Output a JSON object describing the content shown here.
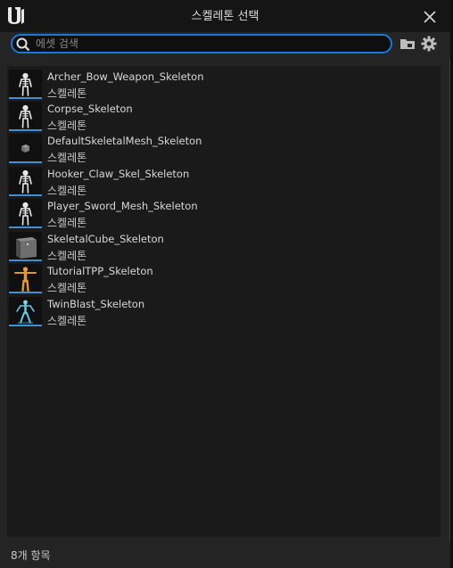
{
  "window": {
    "title": "스켈레톤 선택",
    "colors": {
      "accent": "#1a78d6",
      "background": "#242424",
      "panel": "#1a1a1a"
    }
  },
  "toolbar": {
    "search_placeholder": "에셋 검색",
    "search_value": "",
    "folder_icon": "folder-icon",
    "settings_icon": "gear-icon"
  },
  "assets": [
    {
      "name": "Archer_Bow_Weapon_Skeleton",
      "type": "스켈레톤",
      "thumbnail": "skeleton-white-icon"
    },
    {
      "name": "Corpse_Skeleton",
      "type": "스켈레톤",
      "thumbnail": "skeleton-white-icon"
    },
    {
      "name": "DefaultSkeletalMesh_Skeleton",
      "type": "스켈레톤",
      "thumbnail": "small-cube-icon"
    },
    {
      "name": "Hooker_Claw_Skel_Skeleton",
      "type": "스켈레톤",
      "thumbnail": "skeleton-white-icon"
    },
    {
      "name": "Player_Sword_Mesh_Skeleton",
      "type": "스켈레톤",
      "thumbnail": "skeleton-white-icon"
    },
    {
      "name": "SkeletalCube_Skeleton",
      "type": "스켈레톤",
      "thumbnail": "gray-cube-icon"
    },
    {
      "name": "TutorialTPP_Skeleton",
      "type": "스켈레톤",
      "thumbnail": "mannequin-orange-icon"
    },
    {
      "name": "TwinBlast_Skeleton",
      "type": "스켈레톤",
      "thumbnail": "character-cyan-icon"
    }
  ],
  "status": {
    "item_count": "8개 항목"
  }
}
